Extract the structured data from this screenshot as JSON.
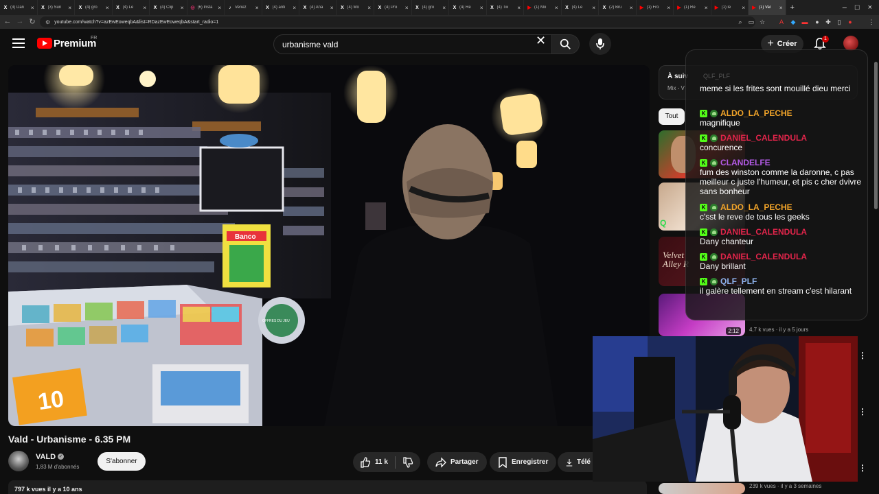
{
  "browser": {
    "tabs": [
      {
        "title": "(3) Dan",
        "icon": "x-icon",
        "glyph": "X",
        "color": "#ffffff"
      },
      {
        "title": "(3) Sun",
        "icon": "x-icon",
        "glyph": "X",
        "color": "#ffffff"
      },
      {
        "title": "(4) gro",
        "icon": "x-icon",
        "glyph": "X",
        "color": "#ffffff"
      },
      {
        "title": "(4) Le",
        "icon": "x-icon",
        "glyph": "X",
        "color": "#ffffff"
      },
      {
        "title": "(4) Clip",
        "icon": "x-icon",
        "glyph": "X",
        "color": "#ffffff"
      },
      {
        "title": "(6) Insta",
        "icon": "instagram-icon",
        "glyph": "◎",
        "color": "#e1306c"
      },
      {
        "title": "Venez",
        "icon": "tiktok-icon",
        "glyph": "♪",
        "color": "#ffffff"
      },
      {
        "title": "(4) anti",
        "icon": "x-icon",
        "glyph": "X",
        "color": "#ffffff"
      },
      {
        "title": "(4) Ana",
        "icon": "x-icon",
        "glyph": "X",
        "color": "#ffffff"
      },
      {
        "title": "(4) Mo",
        "icon": "x-icon",
        "glyph": "X",
        "color": "#ffffff"
      },
      {
        "title": "(4) Pro",
        "icon": "x-icon",
        "glyph": "X",
        "color": "#ffffff"
      },
      {
        "title": "(4) gro",
        "icon": "x-icon",
        "glyph": "X",
        "color": "#ffffff"
      },
      {
        "title": "(4) Re",
        "icon": "x-icon",
        "glyph": "X",
        "color": "#ffffff"
      },
      {
        "title": "(4) Tw",
        "icon": "x-icon",
        "glyph": "X",
        "color": "#ffffff"
      },
      {
        "title": "(1) Mo",
        "icon": "youtube-icon",
        "glyph": "▶",
        "color": "#ff0000"
      },
      {
        "title": "(4) Le",
        "icon": "x-icon",
        "glyph": "X",
        "color": "#ffffff"
      },
      {
        "title": "(2) Bru",
        "icon": "x-icon",
        "glyph": "X",
        "color": "#ffffff"
      },
      {
        "title": "(1) Fro",
        "icon": "youtube-icon",
        "glyph": "▶",
        "color": "#ff0000"
      },
      {
        "title": "(1) Re",
        "icon": "youtube-icon",
        "glyph": "▶",
        "color": "#ff0000"
      },
      {
        "title": "(1) le",
        "icon": "youtube-icon",
        "glyph": "▶",
        "color": "#ff0000"
      },
      {
        "title": "(1) Val",
        "icon": "youtube-icon",
        "glyph": "▶",
        "color": "#ff0000",
        "active": true
      }
    ],
    "url": "youtube.com/watch?v=azEwEoweqbA&list=RDazEwEoweqbA&start_radio=1"
  },
  "header": {
    "logo_text": "Premium",
    "country": "FR",
    "search_value": "urbanisme vald",
    "create_label": "Créer",
    "notification_count": "1"
  },
  "video": {
    "title": "Vald - Urbanisme - 6.35 PM",
    "channel": "VALD",
    "subscribers": "1,83 M d'abonnés",
    "subscribe_label": "S'abonner",
    "likes": "11 k",
    "share_label": "Partager",
    "save_label": "Enregistrer",
    "download_label": "Télé",
    "views_line": "797 k vues  il y a 10 ans",
    "scene_signs": {
      "banco": "Banco",
      "offres": "OFFRES DU JEU",
      "ten": "10"
    }
  },
  "sidebar": {
    "up_next_title": "À suiv",
    "up_next_sub": "Mix - V",
    "chip_all": "Tout",
    "thumb_labels": {
      "velvet": "Velvet Alley R",
      "q": "Q"
    },
    "item_meta": [
      {
        "duration": "2:12",
        "meta": "4,7 k vues · il y a 5 jours"
      },
      {
        "meta": "239 k vues · il y a 3 semaines"
      }
    ]
  },
  "chat": {
    "ghost_line": "QLF_PLF",
    "messages": [
      {
        "user": "",
        "text": "meme si les frites sont mouillé dieu merci",
        "color": "#ffffff"
      },
      {
        "user": "ALDO_LA_PECHE",
        "text": "magnifique",
        "color": "#f0a329"
      },
      {
        "user": "DANIEL_CALENDULA",
        "text": "concurence",
        "color": "#e3254b"
      },
      {
        "user": "CLANDELFE",
        "text": "fum des winston comme la daronne, c pas meilleur c juste l'humeur, et pis c cher dvivre sans bonheur",
        "color": "#b45be8"
      },
      {
        "user": "ALDO_LA_PECHE",
        "text": "c'sst le reve de tous les geeks",
        "color": "#f0a329"
      },
      {
        "user": "DANIEL_CALENDULA",
        "text": "Dany chanteur",
        "color": "#e3254b"
      },
      {
        "user": "DANIEL_CALENDULA",
        "text": "Dany brillant",
        "color": "#e3254b"
      },
      {
        "user": "QLF_PLF",
        "text": "il galère tellement en stream c'est hilarant",
        "color": "#8fb4f0"
      }
    ]
  }
}
